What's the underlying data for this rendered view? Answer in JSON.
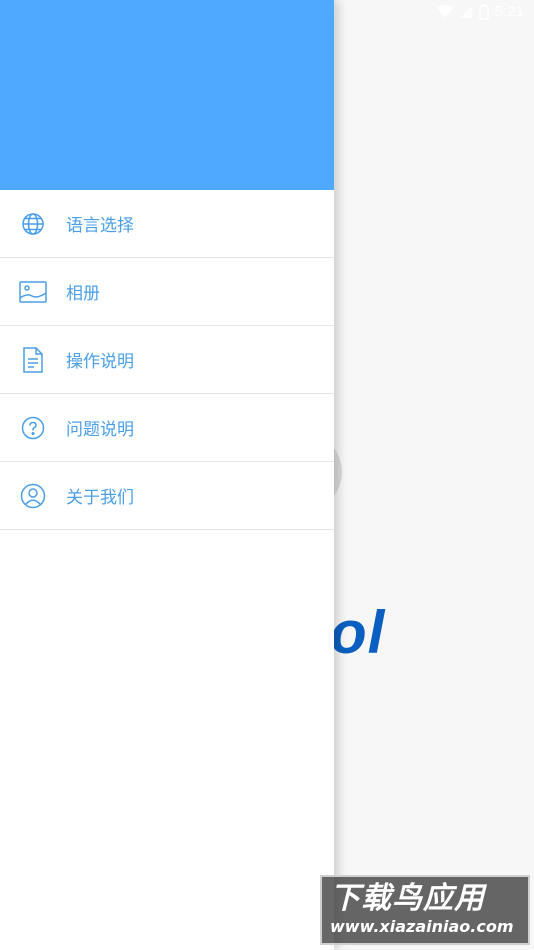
{
  "status_bar": {
    "time": "5:21"
  },
  "background": {
    "logo_fragment": "ol"
  },
  "drawer": {
    "header_color": "#4fa9ff",
    "items": [
      {
        "label": "语言选择",
        "icon": "globe-icon"
      },
      {
        "label": "相册",
        "icon": "image-icon"
      },
      {
        "label": "操作说明",
        "icon": "document-icon"
      },
      {
        "label": "问题说明",
        "icon": "help-circle-icon"
      },
      {
        "label": "关于我们",
        "icon": "user-circle-icon"
      }
    ]
  },
  "watermark": {
    "title": "下载鸟应用",
    "url": "www.xiazainiao.com"
  },
  "colors": {
    "accent": "#4a9fe8",
    "logo": "#0b5fc0",
    "background": "#f7f7f7"
  }
}
